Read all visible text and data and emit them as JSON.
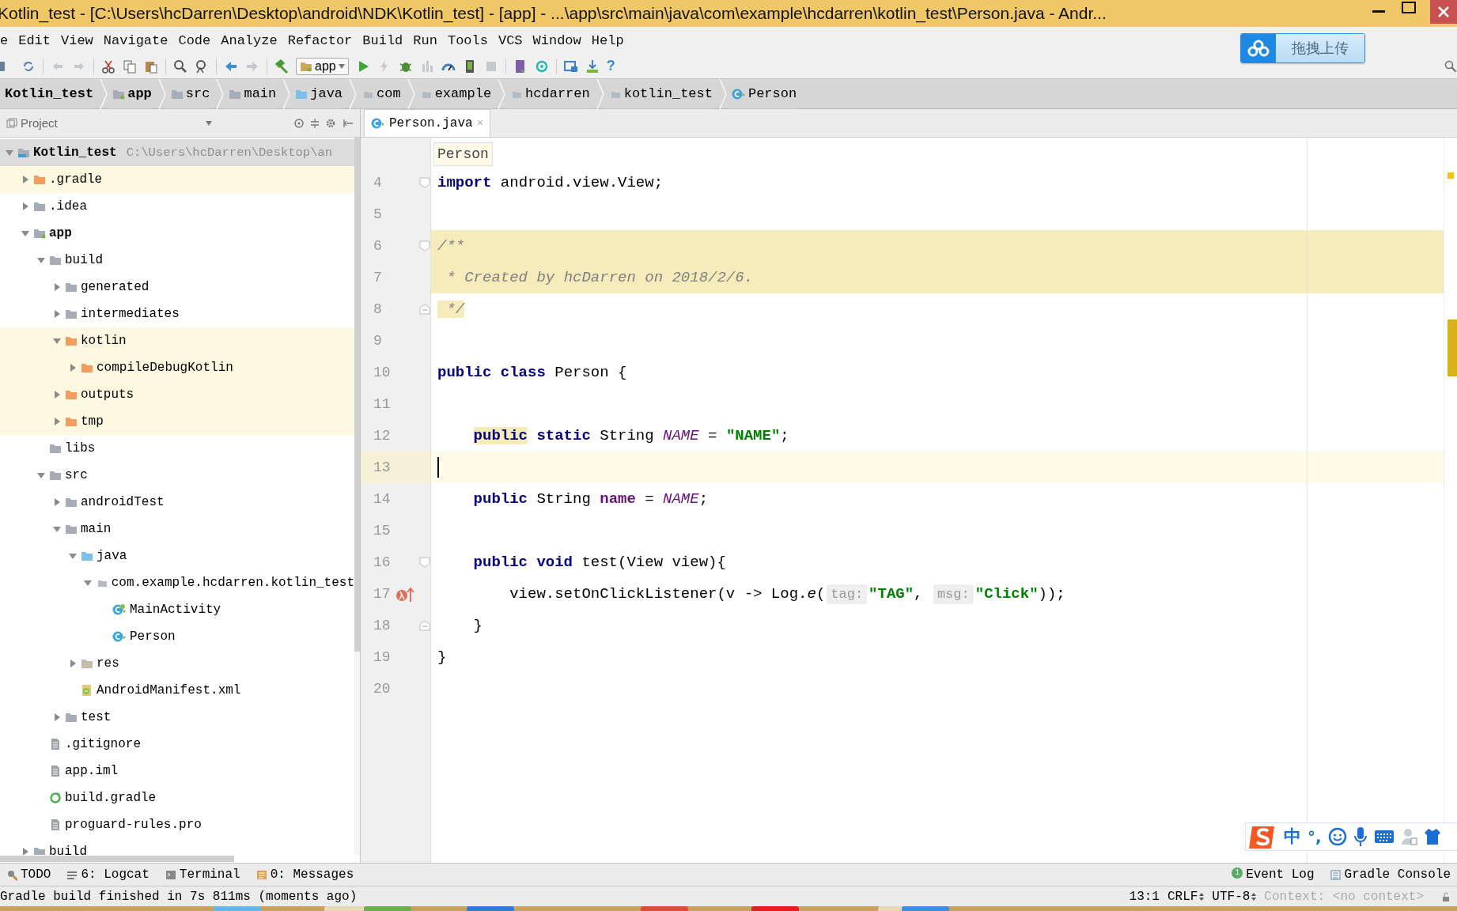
{
  "window": {
    "title": "Kotlin_test - [C:\\Users\\hcDarren\\Desktop\\android\\NDK\\Kotlin_test] - [app] - ...\\app\\src\\main\\java\\com\\example\\hcdarren\\kotlin_test\\Person.java - Andr..."
  },
  "menu": [
    "e",
    "Edit",
    "View",
    "Navigate",
    "Code",
    "Analyze",
    "Refactor",
    "Build",
    "Run",
    "Tools",
    "VCS",
    "Window",
    "Help"
  ],
  "toolbar": {
    "run_config": "app",
    "help": "?"
  },
  "upload_button": {
    "label": "拖拽上传"
  },
  "breadcrumbs": [
    {
      "label": "Kotlin_test",
      "kind": "project"
    },
    {
      "label": "app",
      "kind": "module"
    },
    {
      "label": "src",
      "kind": "folder"
    },
    {
      "label": "main",
      "kind": "folder"
    },
    {
      "label": "java",
      "kind": "source_folder"
    },
    {
      "label": "com",
      "kind": "package"
    },
    {
      "label": "example",
      "kind": "package"
    },
    {
      "label": "hcdarren",
      "kind": "package"
    },
    {
      "label": "kotlin_test",
      "kind": "package"
    },
    {
      "label": "Person",
      "kind": "class"
    }
  ],
  "project_panel": {
    "title": "Project",
    "tree": [
      {
        "label": "Kotlin_test",
        "kind": "project",
        "path": "C:\\Users\\hcDarren\\Desktop\\an",
        "expanded": true,
        "selected": true,
        "children": [
          {
            "label": ".gradle",
            "kind": "excluded_folder",
            "expanded": false,
            "selected": false
          },
          {
            "label": ".idea",
            "kind": "folder",
            "expanded": false,
            "selected": false
          },
          {
            "label": "app",
            "kind": "module",
            "expanded": true,
            "selected": false,
            "children": [
              {
                "label": "build",
                "kind": "folder",
                "expanded": true,
                "selected": false,
                "children": [
                  {
                    "label": "generated",
                    "kind": "folder",
                    "expanded": false,
                    "selected": false
                  },
                  {
                    "label": "intermediates",
                    "kind": "folder",
                    "expanded": false,
                    "selected": false
                  },
                  {
                    "label": "kotlin",
                    "kind": "excluded_folder",
                    "expanded": true,
                    "selected": false,
                    "children": [
                      {
                        "label": "compileDebugKotlin",
                        "kind": "excluded_folder",
                        "expanded": false,
                        "selected": false
                      }
                    ]
                  },
                  {
                    "label": "outputs",
                    "kind": "excluded_folder",
                    "expanded": false,
                    "selected": false
                  },
                  {
                    "label": "tmp",
                    "kind": "excluded_folder",
                    "expanded": false,
                    "selected": false
                  }
                ]
              },
              {
                "label": "libs",
                "kind": "folder",
                "selected": false
              },
              {
                "label": "src",
                "kind": "folder",
                "expanded": true,
                "selected": false,
                "children": [
                  {
                    "label": "androidTest",
                    "kind": "folder",
                    "expanded": false,
                    "selected": false
                  },
                  {
                    "label": "main",
                    "kind": "folder",
                    "expanded": true,
                    "selected": false,
                    "children": [
                      {
                        "label": "java",
                        "kind": "source_folder",
                        "expanded": true,
                        "selected": false,
                        "children": [
                          {
                            "label": "com.example.hcdarren.kotlin_test",
                            "kind": "package",
                            "expanded": true,
                            "selected": false,
                            "children": [
                              {
                                "label": "MainActivity",
                                "kind": "activity_class",
                                "selected": false
                              },
                              {
                                "label": "Person",
                                "kind": "class",
                                "selected": false
                              }
                            ]
                          }
                        ]
                      },
                      {
                        "label": "res",
                        "kind": "resources_folder",
                        "expanded": false,
                        "selected": false
                      },
                      {
                        "label": "AndroidManifest.xml",
                        "kind": "manifest",
                        "selected": false
                      }
                    ]
                  },
                  {
                    "label": "test",
                    "kind": "folder",
                    "expanded": false,
                    "selected": false
                  }
                ]
              },
              {
                "label": ".gitignore",
                "kind": "text_file",
                "selected": false
              },
              {
                "label": "app.iml",
                "kind": "text_file",
                "selected": false
              },
              {
                "label": "build.gradle",
                "kind": "gradle_file",
                "selected": false
              },
              {
                "label": "proguard-rules.pro",
                "kind": "text_file",
                "selected": false
              }
            ]
          },
          {
            "label": "build",
            "kind": "folder",
            "expanded": false,
            "selected": false
          }
        ]
      }
    ]
  },
  "editor": {
    "tabs": [
      {
        "label": "Person.java",
        "close": "×",
        "selected": true
      }
    ],
    "context_label": "Person",
    "lines": [
      {
        "number": "4",
        "kind": "top",
        "gutter_icon": {
          "kind": "fold_start"
        },
        "tokens": [
          {
            "text": "import",
            "kind": "keyword"
          },
          {
            "text": " android.view.View;",
            "kind": "plain"
          }
        ]
      },
      {
        "number": "5"
      },
      {
        "number": "6",
        "kind": "top",
        "gutter_icon": {
          "kind": "fold_start"
        },
        "in_selection": true,
        "tokens": [
          {
            "text": "/**",
            "kind": "comment"
          }
        ]
      },
      {
        "number": "7",
        "kind": "top",
        "in_selection": true,
        "tokens": [
          {
            "text": " * Created by hcDarren on 2018/2/6.",
            "kind": "comment"
          }
        ]
      },
      {
        "number": "8",
        "kind": "top",
        "gutter_icon": {
          "kind": "fold_end"
        },
        "tokens": [
          {
            "text": " */",
            "kind": "comment",
            "highlighted": true
          }
        ]
      },
      {
        "number": "9"
      },
      {
        "number": "10",
        "kind": "top",
        "tokens": [
          {
            "text": "public class",
            "kind": "keyword"
          },
          {
            "text": " Person {",
            "kind": "plain"
          }
        ]
      },
      {
        "number": "11"
      },
      {
        "number": "12",
        "kind": "member",
        "tokens": [
          {
            "text": "public",
            "kind": "keyword",
            "highlighted": true
          },
          {
            "text": " static",
            "kind": "keyword"
          },
          {
            "text": " String ",
            "kind": "plain"
          },
          {
            "text": "NAME",
            "kind": "static_field"
          },
          {
            "text": " = ",
            "kind": "plain"
          },
          {
            "text": "\"NAME\"",
            "kind": "string"
          },
          {
            "text": ";",
            "kind": "plain"
          }
        ]
      },
      {
        "number": "13",
        "current": true
      },
      {
        "number": "14",
        "kind": "member",
        "tokens": [
          {
            "text": "public",
            "kind": "keyword"
          },
          {
            "text": " String ",
            "kind": "plain"
          },
          {
            "text": "name",
            "kind": "field"
          },
          {
            "text": " = ",
            "kind": "plain"
          },
          {
            "text": "NAME",
            "kind": "static_field"
          },
          {
            "text": ";",
            "kind": "plain"
          }
        ]
      },
      {
        "number": "15"
      },
      {
        "number": "16",
        "kind": "member",
        "gutter_icon": {
          "kind": "fold_start"
        },
        "tokens": [
          {
            "text": "public void",
            "kind": "keyword"
          },
          {
            "text": " test(View view){",
            "kind": "plain"
          }
        ]
      },
      {
        "number": "17",
        "kind": "statement",
        "gutter_icon": {
          "kind": "lambda"
        },
        "tokens": [
          {
            "text": "view.setOnClickListener(v -> Log.",
            "kind": "plain"
          },
          {
            "text": "e",
            "kind": "static_method"
          },
          {
            "text": "(",
            "kind": "plain"
          },
          {
            "text": "tag:",
            "kind": "param_hint"
          },
          {
            "text": "\"TAG\"",
            "kind": "string"
          },
          {
            "text": ", ",
            "kind": "plain"
          },
          {
            "text": "msg:",
            "kind": "param_hint"
          },
          {
            "text": "\"Click\"",
            "kind": "string"
          },
          {
            "text": "));",
            "kind": "plain"
          }
        ]
      },
      {
        "number": "18",
        "kind": "member",
        "gutter_icon": {
          "kind": "fold_end"
        },
        "tokens": [
          {
            "text": "}",
            "kind": "plain"
          }
        ]
      },
      {
        "number": "19",
        "kind": "top",
        "tokens": [
          {
            "text": "}",
            "kind": "plain"
          }
        ]
      },
      {
        "number": "20"
      }
    ]
  },
  "ime_bar": {
    "mode": "中",
    "punctuation": "°,"
  },
  "tool_windows": {
    "left": [
      {
        "label": "TODO",
        "kind": "todo"
      },
      {
        "label": "6: Logcat",
        "kind": "logcat"
      },
      {
        "label": "Terminal",
        "kind": "terminal"
      },
      {
        "label": "0: Messages",
        "kind": "messages"
      }
    ],
    "right": [
      {
        "label": "Event Log",
        "kind": "event_log",
        "badge": "1"
      },
      {
        "label": "Gradle Console",
        "kind": "gradle_console"
      }
    ]
  },
  "status_bar": {
    "message": "Gradle build finished in 7s 811ms (moments ago)",
    "position": "13:1",
    "line_separator": "CRLF",
    "encoding": "UTF-8",
    "context": "Context: <no context>"
  }
}
